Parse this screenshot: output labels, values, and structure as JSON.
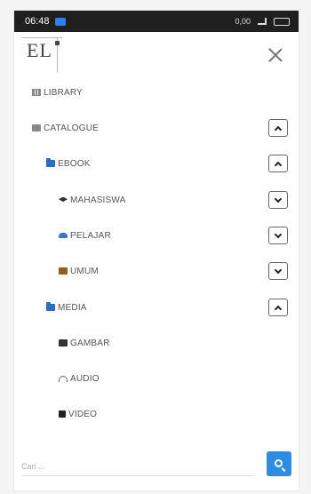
{
  "status_bar": {
    "time": "06:48",
    "indicators": "0,00",
    "battery": "",
    "colors": {
      "background": "#1f1f1f",
      "app_icon": "#2f80ed"
    }
  },
  "header": {
    "logo_text": "EL",
    "close_icon": "close-icon"
  },
  "menu": {
    "library": {
      "label": "LIBRARY",
      "icon": "library-icon"
    },
    "catalogue": {
      "label": "CATALOGUE",
      "icon": "catalogue-icon",
      "expanded": true
    },
    "ebook": {
      "label": "EBOOK",
      "icon": "folder-icon",
      "expanded": true
    },
    "mahasiswa": {
      "label": "MAHASISWA",
      "icon": "graduation-cap-icon",
      "expanded": false
    },
    "pelajar": {
      "label": "PELAJAR",
      "icon": "car-icon",
      "expanded": false
    },
    "umum": {
      "label": "UMUM",
      "icon": "briefcase-icon",
      "expanded": false
    },
    "media": {
      "label": "MEDIA",
      "icon": "folder-icon",
      "expanded": true
    },
    "gambar": {
      "label": "GAMBAR",
      "icon": "image-icon"
    },
    "audio": {
      "label": "AUDIO",
      "icon": "headphones-icon"
    },
    "video": {
      "label": "VIDEO",
      "icon": "video-camera-icon"
    }
  },
  "search": {
    "placeholder": "Cari ...",
    "value": "",
    "button_icon": "search-icon",
    "button_color": "#2d8de0"
  }
}
